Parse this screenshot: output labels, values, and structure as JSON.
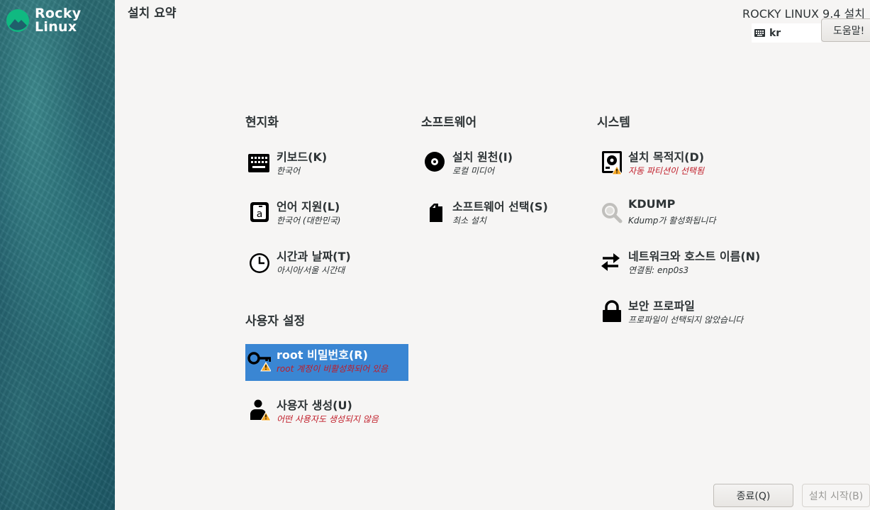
{
  "brand": {
    "name_line1": "Rocky",
    "name_line2": "Linux",
    "accent": "#10b981"
  },
  "header": {
    "page_title": "설치 요약",
    "product_title": "ROCKY LINUX 9.4 설치",
    "keyboard_layout": "kr",
    "help_label": "도움말!"
  },
  "sections": {
    "localization": "현지화",
    "software": "소프트웨어",
    "system": "시스템",
    "user_settings": "사용자 설정"
  },
  "spokes": {
    "keyboard": {
      "title": "키보드(K)",
      "status": "한국어",
      "icon": "keyboard-icon"
    },
    "language": {
      "title": "언어 지원(L)",
      "status": "한국어 (대한민국)",
      "icon": "language-icon"
    },
    "time": {
      "title": "시간과 날짜(T)",
      "status": "아시아/서울 시간대",
      "icon": "clock-icon"
    },
    "source": {
      "title": "설치 원천(I)",
      "status": "로컬 미디어",
      "icon": "disc-icon"
    },
    "software_selection": {
      "title": "소프트웨어 선택(S)",
      "status": "최소 설치",
      "icon": "package-icon"
    },
    "destination": {
      "title": "설치 목적지(D)",
      "status": "자동 파티션이 선택됨",
      "icon": "disk-warning-icon"
    },
    "kdump": {
      "title": "KDUMP",
      "status": "Kdump가 활성화됩니다",
      "icon": "search-icon"
    },
    "network": {
      "title": "네트워크와 호스트 이름(N)",
      "status": "연결됨: enp0s3",
      "icon": "network-arrows-icon"
    },
    "security": {
      "title": "보안 프로파일",
      "status": "프로파일이 선택되지 않았습니다",
      "icon": "lock-icon"
    },
    "root_password": {
      "title": "root 비밀번호(R)",
      "status": "root 계정이 비활성화되어 있음",
      "icon": "key-warning-icon"
    },
    "user_creation": {
      "title": "사용자 생성(U)",
      "status": "어떤 사용자도 생성되지 않음",
      "icon": "user-warning-icon"
    }
  },
  "footer": {
    "quit_label": "종료(Q)",
    "begin_label": "설치 시작(B)"
  },
  "colors": {
    "selected": "#3a86d3",
    "warning_text": "#c01c28",
    "warning_badge": "#f5a623"
  }
}
